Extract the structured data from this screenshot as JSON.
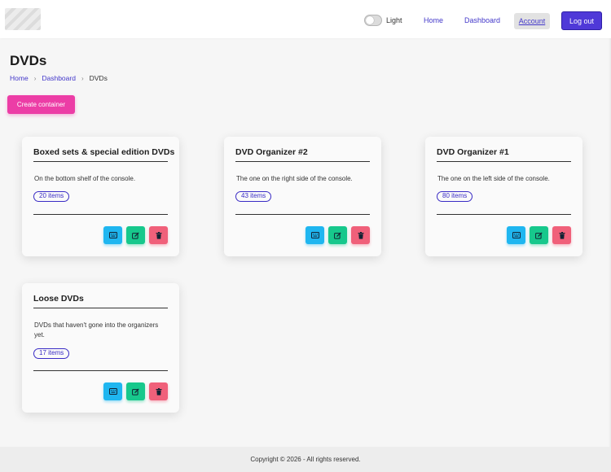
{
  "header": {
    "toggle_label": "Light",
    "nav": {
      "home": "Home",
      "dashboard": "Dashboard",
      "account": "Account"
    },
    "logout_label": "Log out"
  },
  "page": {
    "title": "DVDs",
    "breadcrumb": [
      "Home",
      "Dashboard",
      "DVDs"
    ],
    "create_label": "Create container"
  },
  "containers": [
    {
      "title": "Boxed sets & special edition DVDs",
      "description": "On the bottom shelf of the console.",
      "badge": "20 items"
    },
    {
      "title": "DVD Organizer #2",
      "description": "The one on the right side of the console.",
      "badge": "43 items"
    },
    {
      "title": "DVD Organizer #1",
      "description": "The one on the left side of the console.",
      "badge": "80 items"
    },
    {
      "title": "Loose DVDs",
      "description": "DVDs that haven't gone into the organizers yet.",
      "badge": "17 items"
    }
  ],
  "colors": {
    "primary": "#4f39d8",
    "create": "#ec3da6",
    "view": "#1fb6f0",
    "edit": "#17c88c",
    "delete": "#f0607a"
  },
  "icons": {
    "view": "keyboard-icon",
    "edit": "edit-icon",
    "delete": "trash-icon"
  },
  "footer": {
    "copyright": "Copyright © 2026 - All rights reserved."
  }
}
